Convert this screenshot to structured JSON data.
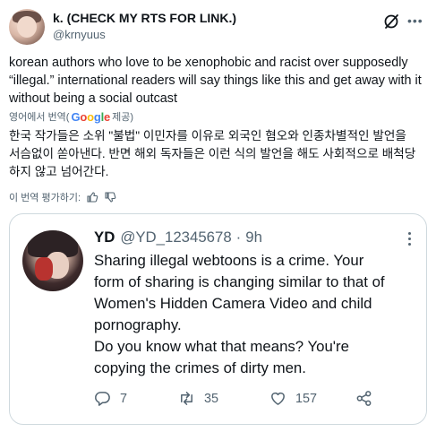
{
  "author": {
    "name": "k. (CHECK MY RTS FOR LINK.)",
    "handle": "@krnyuus"
  },
  "tweet": {
    "lines": [
      "korean authors who love to be xenophobic and racist over supposedly",
      "“illegal.” international readers will say things like this and get away with it",
      "without being a social outcast"
    ]
  },
  "translation_label": {
    "prefix": "영어에서 번역(",
    "google": [
      "G",
      "o",
      "o",
      "g",
      "l",
      "e"
    ],
    "suffix": " 제공)"
  },
  "translation": {
    "lines": [
      "한국 작가들은 소위 \"불법\" 이민자를 이유로 외국인 혐오와 인종차별적인 발언을",
      "서슴없이 쏟아낸다. 반면 해외 독자들은 이런 식의 발언을 해도 사회적으로 배척당",
      "하지 않고 넘어간다."
    ]
  },
  "rate": {
    "label": "이 번역 평가하기:"
  },
  "quote": {
    "name": "YD",
    "handle": "@YD_12345678",
    "dot": "·",
    "time": "9h",
    "lines": [
      "Sharing illegal webtoons is a crime. Your",
      "form of sharing is changing similar to that of",
      "Women's Hidden Camera Video and child",
      "pornography.",
      "Do you know what that means? You're",
      "copying the crimes of dirty men."
    ],
    "actions": {
      "replies": "7",
      "reposts": "35",
      "likes": "157"
    }
  },
  "icons": [
    "grok-icon",
    "more-icon",
    "thumbs-up-icon",
    "thumbs-down-icon",
    "reply-icon",
    "repost-icon",
    "like-icon",
    "share-icon"
  ]
}
